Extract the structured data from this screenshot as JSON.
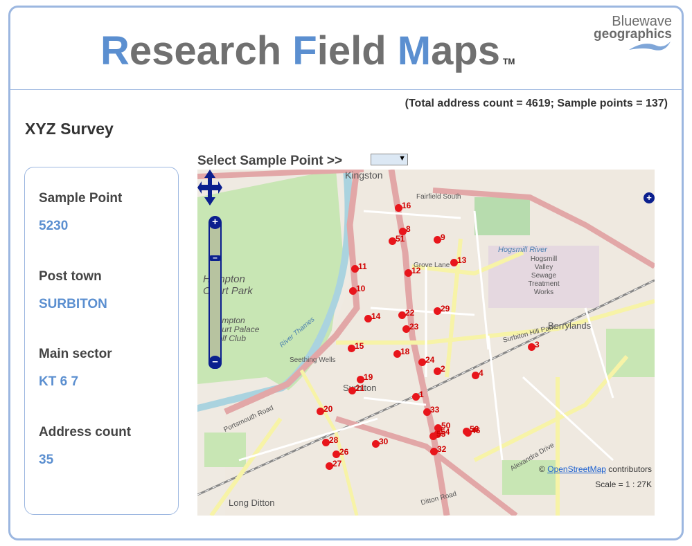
{
  "header": {
    "title_parts": [
      {
        "text": "R",
        "accent": true
      },
      {
        "text": "esearch ",
        "accent": false
      },
      {
        "text": "F",
        "accent": true
      },
      {
        "text": "ield ",
        "accent": false
      },
      {
        "text": "M",
        "accent": true
      },
      {
        "text": "aps",
        "accent": false
      }
    ],
    "trademark": "TM",
    "logo_line1": "Bluewave",
    "logo_line2": "geographics"
  },
  "totals_text": "(Total address count = 4619; Sample points = 137)",
  "survey_title": "XYZ Survey",
  "select": {
    "label": "Select Sample Point >>",
    "value": ""
  },
  "info": {
    "sample_point_label": "Sample Point",
    "sample_point_value": "5230",
    "post_town_label": "Post town",
    "post_town_value": "SURBITON",
    "main_sector_label": "Main sector",
    "main_sector_value": "KT 6 7",
    "address_count_label": "Address count",
    "address_count_value": "35"
  },
  "map": {
    "attribution_prefix": "©",
    "attribution_link": "OpenStreetMap",
    "attribution_suffix": "contributors",
    "scale_text": "Scale = 1 : 27K",
    "place_labels": {
      "kingston": "Kingston",
      "hampton_court_park": "Hampton Court Park",
      "hampton_court_palace": "Hampton Court Palace Golf Club",
      "berrylands": "Berrylands",
      "surbiton": "Surbiton",
      "seething_wells": "Seething Wells",
      "long_ditton": "Long Ditton",
      "hogsmill": "Hogsmill Valley Sewage Treatment Works",
      "hogsmill_river": "Hogsmill River",
      "river_thames": "River Thames",
      "fairfield_south": "Fairfield South",
      "grove_lane": "Grove Lane",
      "surbiton_hill_park": "Surbiton Hill Park",
      "alexandra_drive": "Alexandra Drive",
      "portsmouth_road": "Portsmouth Road",
      "ditton_road": "Ditton Road"
    },
    "points": [
      {
        "id": "1"
      },
      {
        "id": "2"
      },
      {
        "id": "3"
      },
      {
        "id": "4"
      },
      {
        "id": "8"
      },
      {
        "id": "9"
      },
      {
        "id": "10"
      },
      {
        "id": "11"
      },
      {
        "id": "12"
      },
      {
        "id": "13"
      },
      {
        "id": "14"
      },
      {
        "id": "15"
      },
      {
        "id": "16"
      },
      {
        "id": "18"
      },
      {
        "id": "19"
      },
      {
        "id": "20"
      },
      {
        "id": "21"
      },
      {
        "id": "22"
      },
      {
        "id": "23"
      },
      {
        "id": "24"
      },
      {
        "id": "26"
      },
      {
        "id": "27"
      },
      {
        "id": "28"
      },
      {
        "id": "29"
      },
      {
        "id": "30"
      },
      {
        "id": "32"
      },
      {
        "id": "33"
      },
      {
        "id": "46"
      },
      {
        "id": "50"
      },
      {
        "id": "51"
      },
      {
        "id": "54"
      },
      {
        "id": "55"
      },
      {
        "id": "56"
      }
    ]
  },
  "colors": {
    "accent": "#5b8fd0",
    "frame": "#9cb7e0",
    "point": "#e8151b",
    "nav": "#0b1f8e"
  }
}
